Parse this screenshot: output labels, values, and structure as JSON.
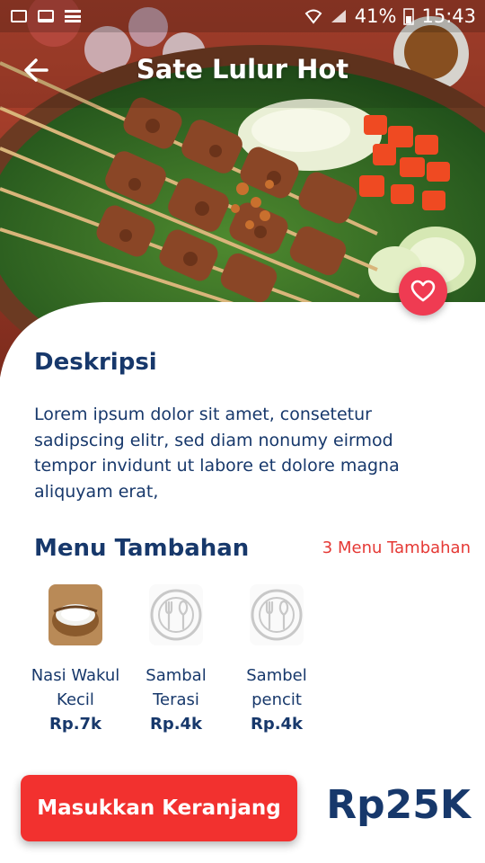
{
  "status_bar": {
    "battery": "41%",
    "time": "15:43"
  },
  "header": {
    "title": "Sate Lulur Hot"
  },
  "description": {
    "title": "Deskripsi",
    "text": "Lorem ipsum dolor sit amet, consetetur sadipscing elitr, sed diam nonumy eirmod tempor invidunt ut labore et dolore magna aliquyam erat,"
  },
  "addons": {
    "title": "Menu Tambahan",
    "count": "3 Menu Tambahan",
    "items": [
      {
        "name": "Nasi Wakul Kecil",
        "price": "Rp.7k",
        "icon": "rice-basket-image"
      },
      {
        "name": "Sambal Terasi",
        "price": "Rp.4k",
        "icon": "plate-utensils-icon"
      },
      {
        "name": "Sambel pencit",
        "price": "Rp.4k",
        "icon": "plate-utensils-icon"
      }
    ]
  },
  "footer": {
    "cart_button": "Masukkan Keranjang",
    "price": "Rp25K"
  },
  "colors": {
    "primary_text": "#17386b",
    "accent_red": "#f2312f",
    "favorite": "#ef3b52"
  }
}
